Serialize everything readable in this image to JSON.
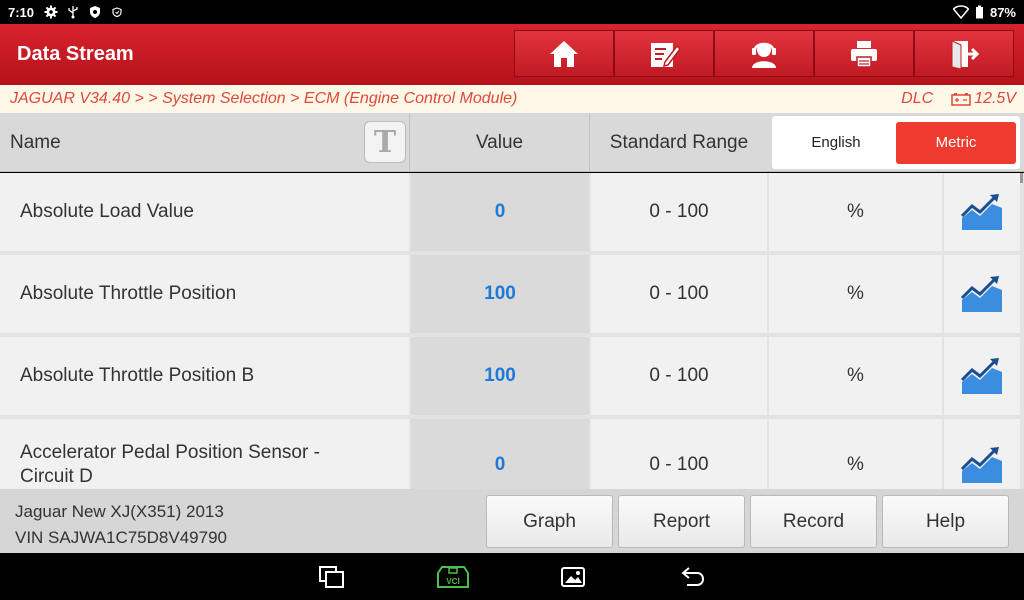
{
  "status_bar": {
    "time": "7:10",
    "battery": "87%",
    "icons": [
      "gear-icon",
      "usb-icon",
      "shield-icon",
      "shield-small-icon",
      "wifi-icon",
      "battery-icon"
    ]
  },
  "header": {
    "title": "Data Stream",
    "toolbar": [
      "home-icon",
      "edit-report-icon",
      "support-agent-icon",
      "printer-icon",
      "exit-icon"
    ]
  },
  "breadcrumb": {
    "path": "JAGUAR V34.40 >  > System Selection > ECM (Engine Control Module)",
    "dlc": "DLC",
    "voltage": "12.5V"
  },
  "table": {
    "headers": {
      "name": "Name",
      "value": "Value",
      "range": "Standard Range"
    },
    "unit_toggle": {
      "english": "English",
      "metric": "Metric",
      "selected": "Metric"
    },
    "rows": [
      {
        "name": "Absolute Load Value",
        "value": "0",
        "range": "0 - 100",
        "unit": "%"
      },
      {
        "name": "Absolute Throttle Position",
        "value": "100",
        "range": "0 - 100",
        "unit": "%"
      },
      {
        "name": "Absolute Throttle Position B",
        "value": "100",
        "range": "0 - 100",
        "unit": "%"
      },
      {
        "name": "Accelerator Pedal Position Sensor - Circuit D",
        "value": "0",
        "range": "0 - 100",
        "unit": "%"
      }
    ]
  },
  "footer": {
    "vehicle": "Jaguar New XJ(X351) 2013",
    "vin": "VIN SAJWA1C75D8V49790",
    "buttons": {
      "graph": "Graph",
      "report": "Report",
      "record": "Record",
      "help": "Help"
    }
  },
  "nav_bar": {
    "vci_label": "VCI",
    "icons": [
      "recent-apps-icon",
      "vci-icon",
      "gallery-icon",
      "back-icon"
    ]
  },
  "colors": {
    "header_red": "#c8161f",
    "value_blue": "#1e7ad8",
    "toggle_active": "#ee3a2f"
  }
}
